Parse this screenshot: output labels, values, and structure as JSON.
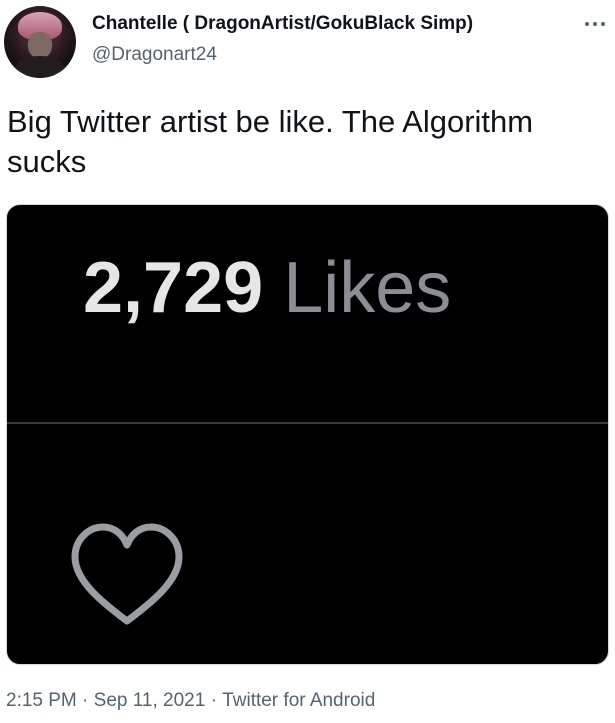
{
  "author": {
    "display_name": "Chantelle ( DragonArtist/GokuBlack Simp)",
    "handle": "@Dragonart24",
    "more_icon": "more-horizontal-icon"
  },
  "tweet": {
    "text": "Big Twitter artist be like. The Algorithm sucks"
  },
  "media": {
    "likes_count": "2,729",
    "likes_word": "Likes",
    "heart_icon": "heart-outline-icon",
    "background": "#000000",
    "count_color": "#e6e6e6",
    "word_color": "#8b8f95"
  },
  "meta": {
    "time": "2:15 PM",
    "separator": "·",
    "date": "Sep 11, 2021",
    "source": "Twitter for Android"
  }
}
